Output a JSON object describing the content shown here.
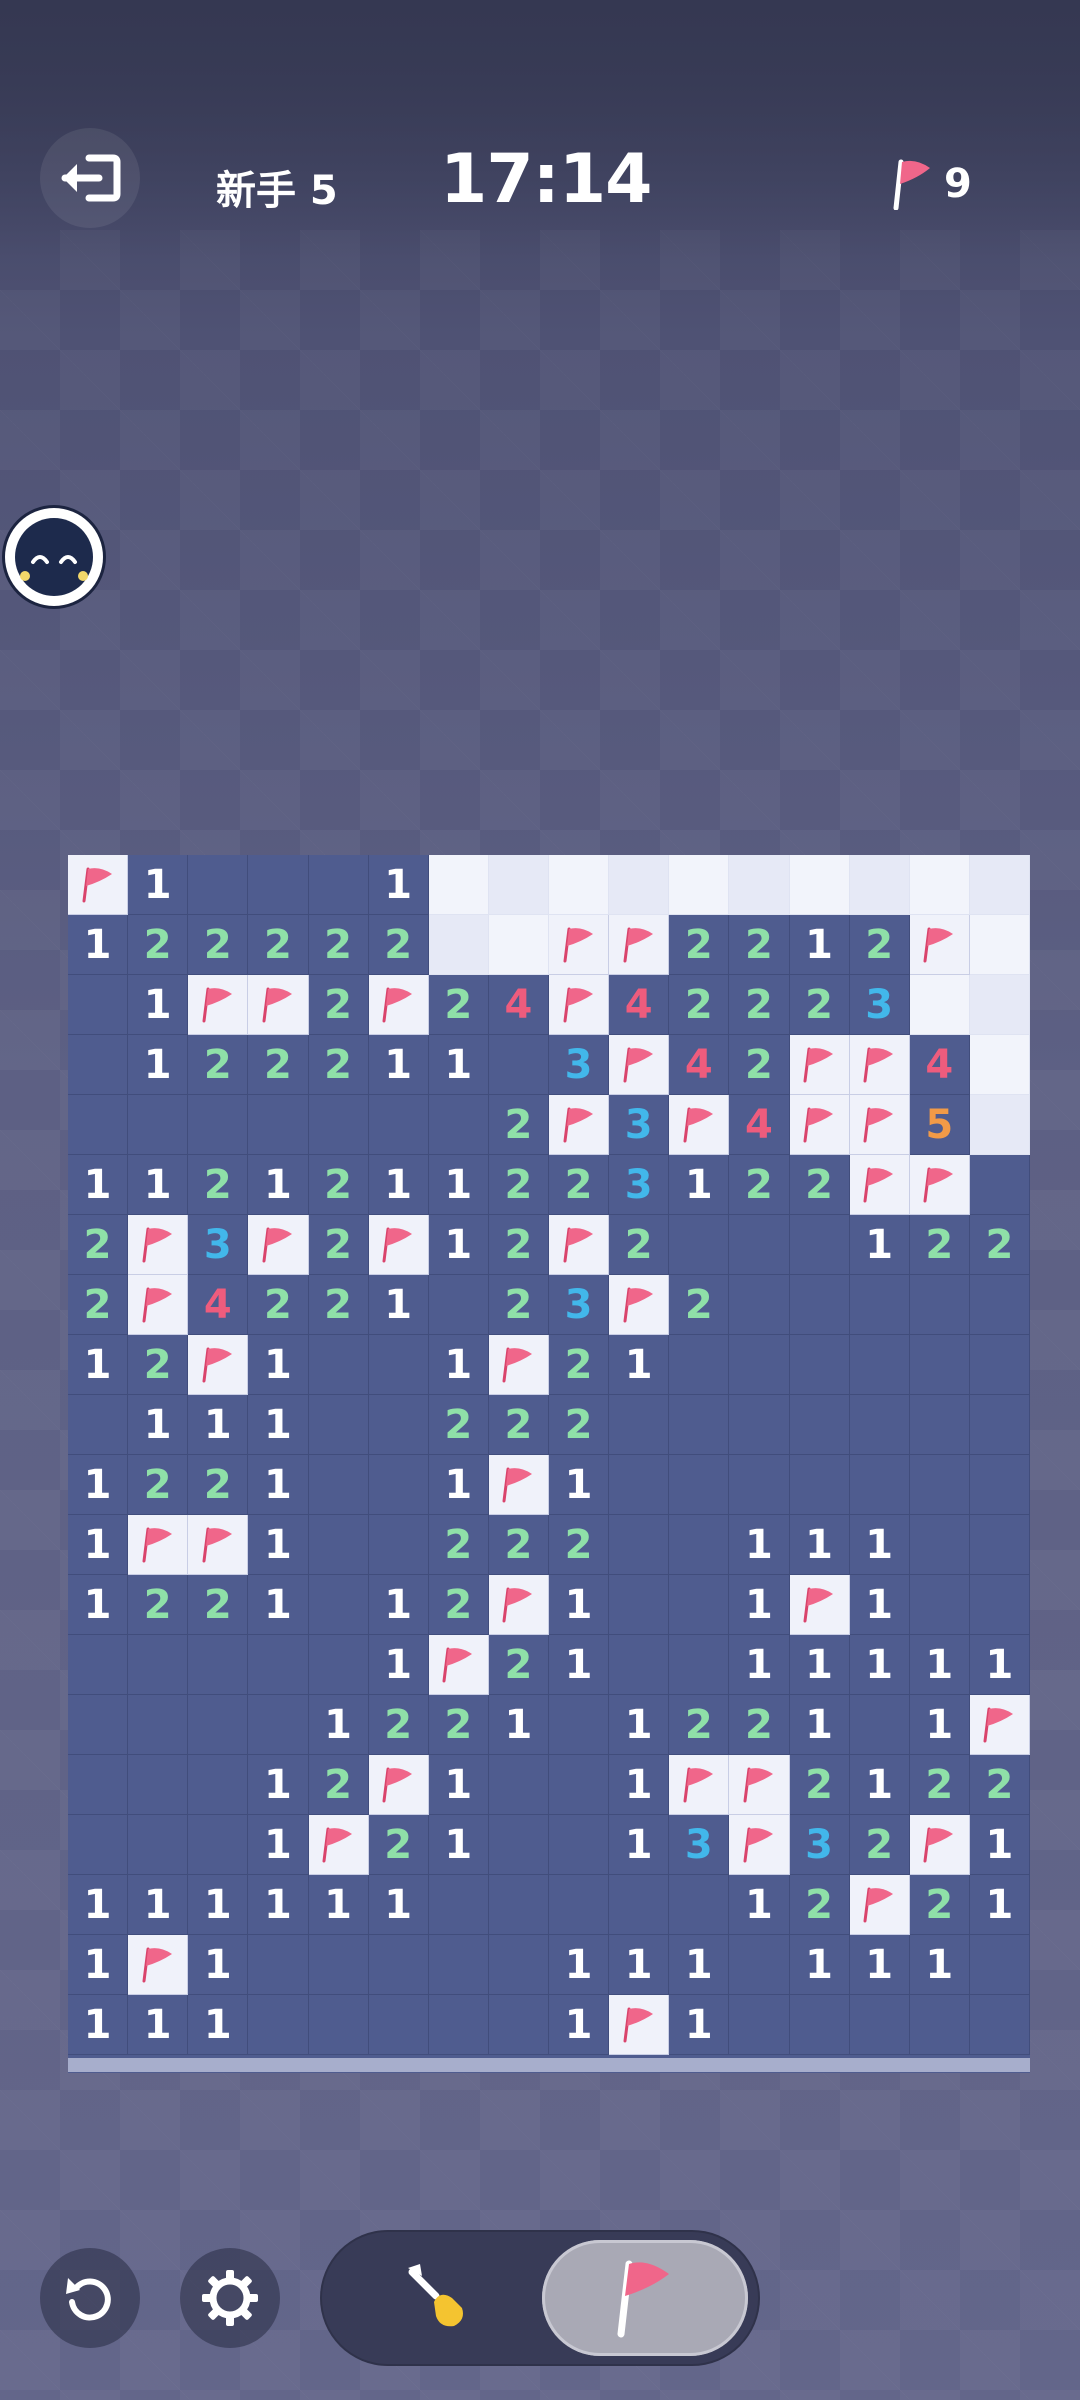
{
  "header": {
    "level": "新手 5",
    "timer": "17:14",
    "flags_remaining": "9",
    "exit_icon": "exit-icon",
    "flag_icon": "flag-icon"
  },
  "colors": {
    "flag": "#f0668a",
    "covered": "#4f5c8f",
    "hidden": "#e6e9f6",
    "n1": "#ffffff",
    "n2": "#8fe0a8",
    "n3": "#42b7ea",
    "n4": "#ee5c7d",
    "n5": "#f19a47"
  },
  "board": {
    "cols": 16,
    "rows": [
      "F1   1HHHHHHHHHH",
      "122222HHFF2212FH",
      " 1FF2F24F42223HH",
      " 122211 3F42FF4H",
      "       2F3F4FF5H",
      "1121211223122FF ",
      "2F3F2F12F2   122",
      "2F4221 23F2     ",
      "12F1  1F21      ",
      " 111  222       ",
      "1221  1F1       ",
      "1FF1  222  111  ",
      "1221 12F1  1F1  ",
      "     1F21  11111",
      "    1221 1221 1F",
      "   12F1  1FF2122",
      "   1F21  13F32F1",
      "111111     12F211",
      "1F1     111 111  ",
      "111     1F1      "
    ]
  },
  "controls": {
    "restart_icon": "restart-icon",
    "settings_icon": "settings-icon",
    "dig_icon": "shovel-icon",
    "flag_mode_icon": "flag-icon",
    "active_mode": "flag"
  }
}
